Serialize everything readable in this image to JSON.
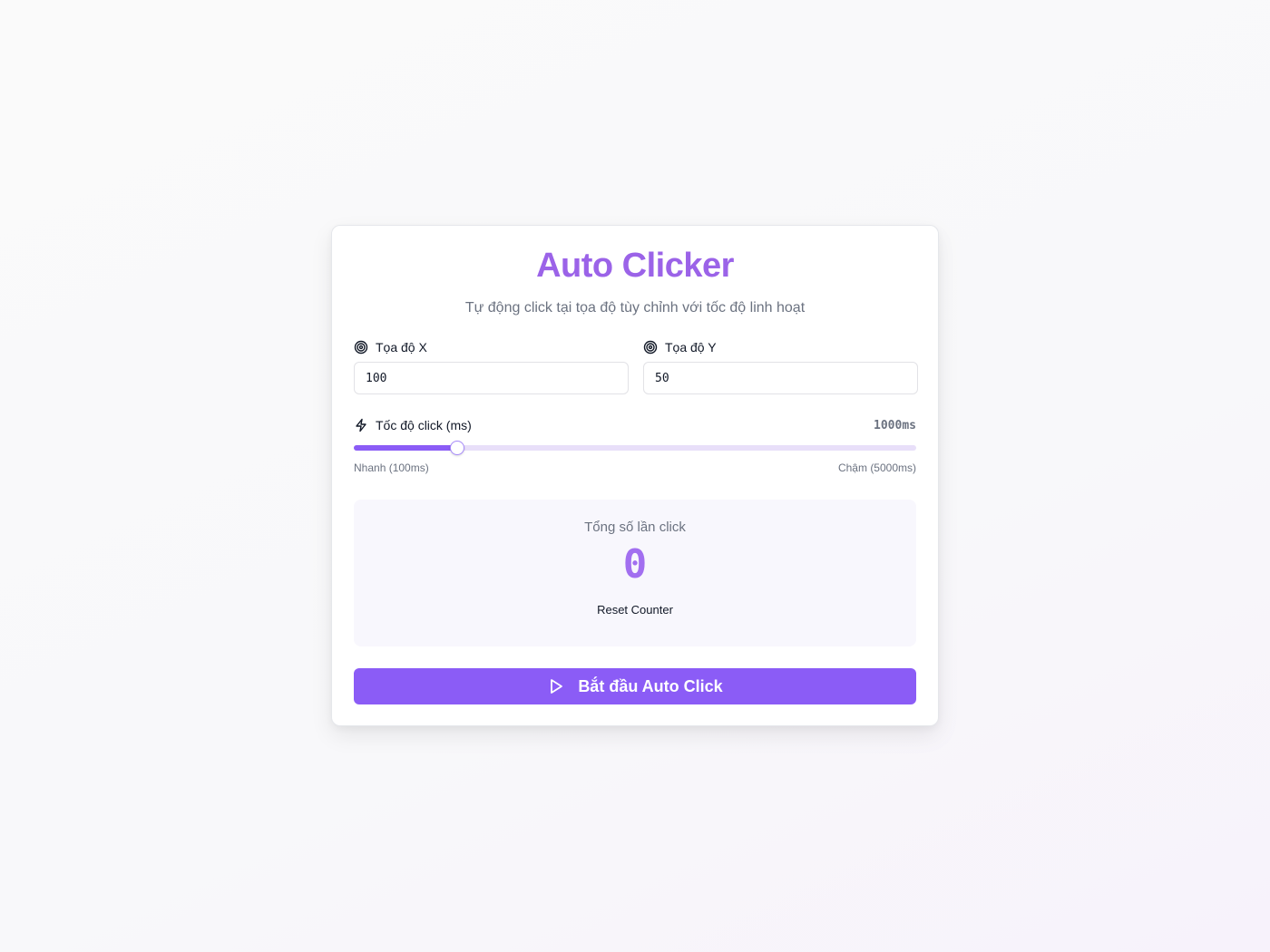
{
  "app": {
    "title": "Auto Clicker",
    "subtitle": "Tự động click tại tọa độ tùy chỉnh với tốc độ linh hoạt",
    "accent_color": "#8b5cf6",
    "title_color": "#9b63e8"
  },
  "coordinates": {
    "x": {
      "label": "Tọa độ X",
      "value": "100",
      "icon": "target-icon"
    },
    "y": {
      "label": "Tọa độ Y",
      "value": "50",
      "icon": "target-icon"
    }
  },
  "speed": {
    "label": "Tốc độ click (ms)",
    "icon": "lightning-icon",
    "value_display": "1000ms",
    "value": 1000,
    "min": 100,
    "max": 5000,
    "min_label": "Nhanh (100ms)",
    "max_label": "Chậm (5000ms)"
  },
  "counter": {
    "label": "Tổng số lần click",
    "value": "0",
    "reset_label": "Reset Counter"
  },
  "start_button": {
    "label": "Bắt đầu Auto Click",
    "icon": "play-icon"
  }
}
